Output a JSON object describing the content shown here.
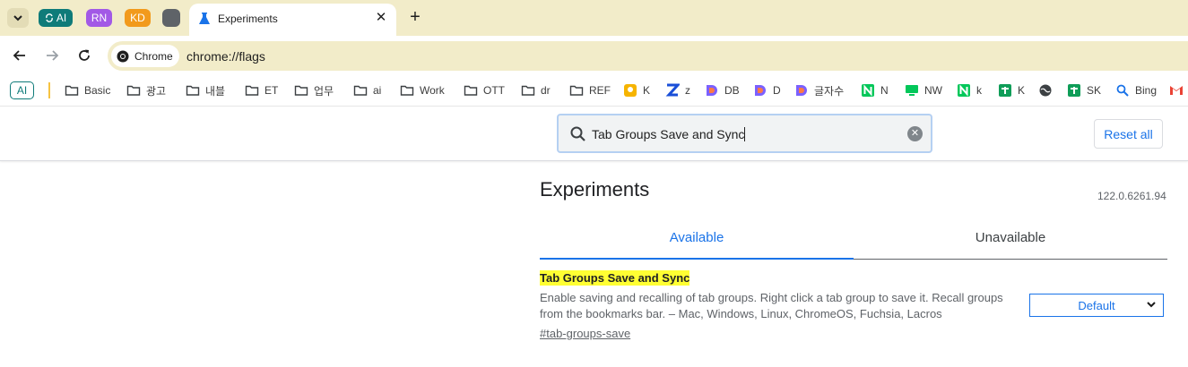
{
  "tabstrip": {
    "groups": [
      {
        "label": "AI",
        "color": "#0f7b79"
      },
      {
        "label": "RN",
        "color": "#a259e6"
      },
      {
        "label": "KD",
        "color": "#f29a1c"
      },
      {
        "label": "",
        "color": "#5f6368"
      }
    ],
    "active_tab_title": "Experiments",
    "new_tab_symbol": "+",
    "close_symbol": "✕"
  },
  "toolbar": {
    "site_chip": "Chrome",
    "url": "chrome://flags"
  },
  "bookmarks": {
    "ai_label": "AI",
    "items": [
      {
        "label": "Basic",
        "icon": "folder-icon"
      },
      {
        "label": "광고",
        "icon": "folder-icon"
      },
      {
        "label": "내블",
        "icon": "folder-icon"
      },
      {
        "label": "ET",
        "icon": "folder-icon"
      },
      {
        "label": "업무",
        "icon": "folder-icon"
      },
      {
        "label": "ai",
        "icon": "folder-icon"
      },
      {
        "label": "Work",
        "icon": "folder-icon"
      },
      {
        "label": "OTT",
        "icon": "folder-icon"
      },
      {
        "label": "dr",
        "icon": "folder-icon"
      },
      {
        "label": "REF",
        "icon": "folder-icon"
      },
      {
        "label": "K",
        "icon": "bulb-icon"
      },
      {
        "label": "z",
        "icon": "z-icon"
      },
      {
        "label": "DB",
        "icon": "d-icon"
      },
      {
        "label": "D",
        "icon": "d-icon"
      },
      {
        "label": "글자수",
        "icon": "d-icon"
      },
      {
        "label": "N",
        "icon": "naver-icon"
      },
      {
        "label": "NW",
        "icon": "monitor-icon"
      },
      {
        "label": "k",
        "icon": "naver-icon"
      },
      {
        "label": "K",
        "icon": "sheets-icon"
      },
      {
        "label": "",
        "icon": "globe-icon"
      },
      {
        "label": "SK",
        "icon": "sheets-icon"
      },
      {
        "label": "Bing",
        "icon": "search-icon"
      },
      {
        "label": "",
        "icon": "gmail-icon"
      }
    ]
  },
  "flags": {
    "search_value": "Tab Groups Save and Sync",
    "reset_label": "Reset all",
    "heading": "Experiments",
    "version": "122.0.6261.94",
    "tabs": {
      "available": "Available",
      "unavailable": "Unavailable"
    },
    "experiment": {
      "title": "Tab Groups Save and Sync",
      "description": "Enable saving and recalling of tab groups. Right click a tab group to save it. Recall groups from the bookmarks bar. – Mac, Windows, Linux, ChromeOS, Fuchsia, Lacros",
      "link": "#tab-groups-save",
      "select_value": "Default"
    }
  },
  "colors": {
    "accent": "#1a73e8",
    "frame": "#f2ecc9",
    "highlight": "#ffff33"
  }
}
